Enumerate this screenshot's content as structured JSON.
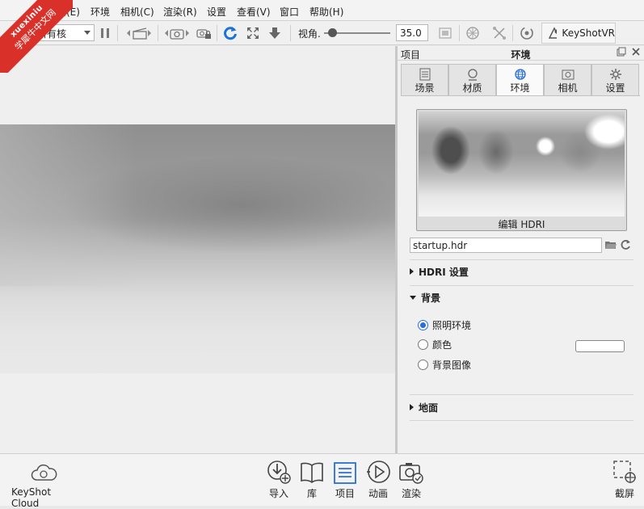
{
  "watermark": {
    "line1": "xuexiniu",
    "line2": "学犀牛中文网"
  },
  "menu": {
    "items": [
      "编辑(E)",
      "环境",
      "相机(C)",
      "渲染(R)",
      "设置",
      "查看(V)",
      "窗口",
      "帮助(H)"
    ]
  },
  "toolbar": {
    "core_select": "所有核",
    "fov_label": "视角.",
    "fov_value": "35.0",
    "fov_slider_fraction": 0.13,
    "vr_label": "KeyShotVR"
  },
  "panel": {
    "header_left": "项目",
    "header_title": "环境",
    "tabs": [
      {
        "label": "场景",
        "icon": "list-icon"
      },
      {
        "label": "材质",
        "icon": "material-ball-icon"
      },
      {
        "label": "环境",
        "icon": "globe-icon",
        "active": true
      },
      {
        "label": "相机",
        "icon": "camera-icon"
      },
      {
        "label": "设置",
        "icon": "gear-icon"
      }
    ],
    "hdri_edit_label": "编辑 HDRI",
    "hdri_file": "startup.hdr",
    "sections": {
      "hdri_settings": "HDRI 设置",
      "background": "背景",
      "ground": "地面"
    },
    "background_options": [
      "照明环境",
      "颜色",
      "背景图像"
    ],
    "background_selected": "照明环境",
    "background_color": "#ffffff"
  },
  "bottombar": {
    "cloud_label": "KeyShot Cloud",
    "buttons": [
      "导入",
      "库",
      "项目",
      "动画",
      "渲染"
    ],
    "active_button": "项目",
    "screenshot_label": "截屏"
  },
  "colors": {
    "accent": "#2a6fd6",
    "watermark": "#d9302a",
    "refresh_blue": "#1a73d9"
  }
}
